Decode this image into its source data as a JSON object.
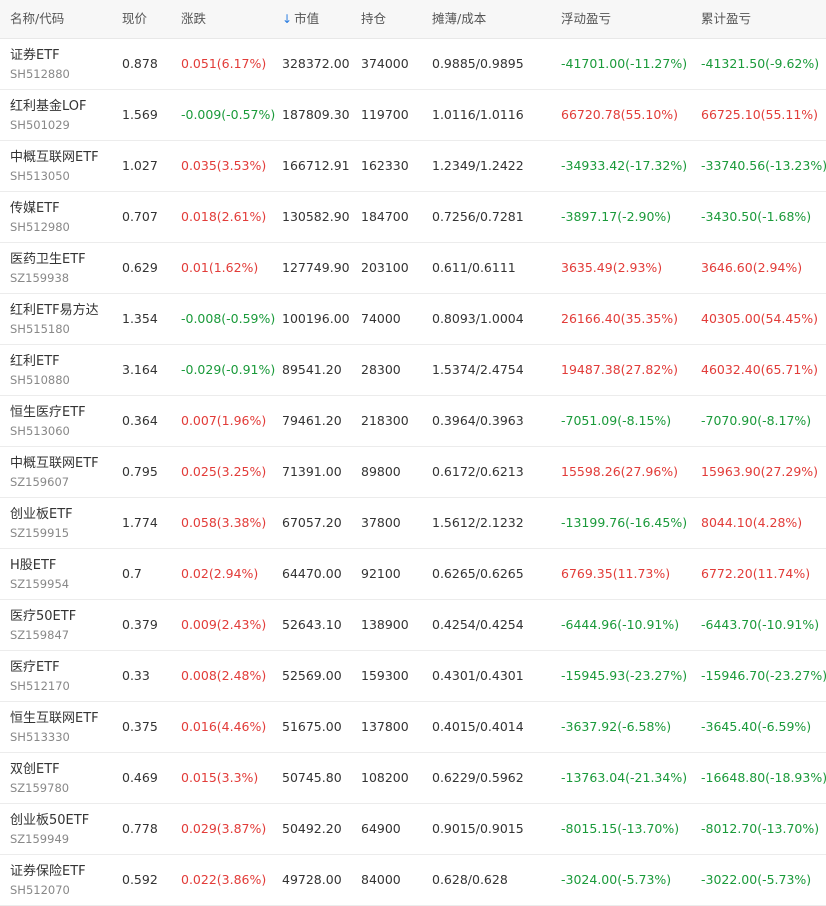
{
  "colors": {
    "up": "#e23c39",
    "down": "#1a9a3a",
    "header_bg": "#f7f7f7",
    "sort_arrow": "#2a7de1"
  },
  "header": {
    "name_code": "名称/代码",
    "price": "现价",
    "change": "涨跌",
    "sort_icon": "↓",
    "market_value": "市值",
    "position": "持仓",
    "cost": "摊薄/成本",
    "floating_pl": "浮动盈亏",
    "total_pl": "累计盈亏"
  },
  "rows": [
    {
      "name": "证券ETF",
      "code": "SH512880",
      "price": "0.878",
      "change": "0.051(6.17%)",
      "change_dir": "up",
      "market_value": "328372.00",
      "position": "374000",
      "cost": "0.9885/0.9895",
      "floating_pl": "-41701.00(-11.27%)",
      "floating_dir": "down",
      "total_pl": "-41321.50(-9.62%)",
      "total_dir": "down"
    },
    {
      "name": "红利基金LOF",
      "code": "SH501029",
      "price": "1.569",
      "change": "-0.009(-0.57%)",
      "change_dir": "down",
      "market_value": "187809.30",
      "position": "119700",
      "cost": "1.0116/1.0116",
      "floating_pl": "66720.78(55.10%)",
      "floating_dir": "up",
      "total_pl": "66725.10(55.11%)",
      "total_dir": "up"
    },
    {
      "name": "中概互联网ETF",
      "code": "SH513050",
      "price": "1.027",
      "change": "0.035(3.53%)",
      "change_dir": "up",
      "market_value": "166712.91",
      "position": "162330",
      "cost": "1.2349/1.2422",
      "floating_pl": "-34933.42(-17.32%)",
      "floating_dir": "down",
      "total_pl": "-33740.56(-13.23%)",
      "total_dir": "down"
    },
    {
      "name": "传媒ETF",
      "code": "SH512980",
      "price": "0.707",
      "change": "0.018(2.61%)",
      "change_dir": "up",
      "market_value": "130582.90",
      "position": "184700",
      "cost": "0.7256/0.7281",
      "floating_pl": "-3897.17(-2.90%)",
      "floating_dir": "down",
      "total_pl": "-3430.50(-1.68%)",
      "total_dir": "down"
    },
    {
      "name": "医药卫生ETF",
      "code": "SZ159938",
      "price": "0.629",
      "change": "0.01(1.62%)",
      "change_dir": "up",
      "market_value": "127749.90",
      "position": "203100",
      "cost": "0.611/0.6111",
      "floating_pl": "3635.49(2.93%)",
      "floating_dir": "up",
      "total_pl": "3646.60(2.94%)",
      "total_dir": "up"
    },
    {
      "name": "红利ETF易方达",
      "code": "SH515180",
      "price": "1.354",
      "change": "-0.008(-0.59%)",
      "change_dir": "down",
      "market_value": "100196.00",
      "position": "74000",
      "cost": "0.8093/1.0004",
      "floating_pl": "26166.40(35.35%)",
      "floating_dir": "up",
      "total_pl": "40305.00(54.45%)",
      "total_dir": "up"
    },
    {
      "name": "红利ETF",
      "code": "SH510880",
      "price": "3.164",
      "change": "-0.029(-0.91%)",
      "change_dir": "down",
      "market_value": "89541.20",
      "position": "28300",
      "cost": "1.5374/2.4754",
      "floating_pl": "19487.38(27.82%)",
      "floating_dir": "up",
      "total_pl": "46032.40(65.71%)",
      "total_dir": "up"
    },
    {
      "name": "恒生医疗ETF",
      "code": "SH513060",
      "price": "0.364",
      "change": "0.007(1.96%)",
      "change_dir": "up",
      "market_value": "79461.20",
      "position": "218300",
      "cost": "0.3964/0.3963",
      "floating_pl": "-7051.09(-8.15%)",
      "floating_dir": "down",
      "total_pl": "-7070.90(-8.17%)",
      "total_dir": "down"
    },
    {
      "name": "中概互联网ETF",
      "code": "SZ159607",
      "price": "0.795",
      "change": "0.025(3.25%)",
      "change_dir": "up",
      "market_value": "71391.00",
      "position": "89800",
      "cost": "0.6172/0.6213",
      "floating_pl": "15598.26(27.96%)",
      "floating_dir": "up",
      "total_pl": "15963.90(27.29%)",
      "total_dir": "up"
    },
    {
      "name": "创业板ETF",
      "code": "SZ159915",
      "price": "1.774",
      "change": "0.058(3.38%)",
      "change_dir": "up",
      "market_value": "67057.20",
      "position": "37800",
      "cost": "1.5612/2.1232",
      "floating_pl": "-13199.76(-16.45%)",
      "floating_dir": "down",
      "total_pl": "8044.10(4.28%)",
      "total_dir": "up"
    },
    {
      "name": "H股ETF",
      "code": "SZ159954",
      "price": "0.7",
      "change": "0.02(2.94%)",
      "change_dir": "up",
      "market_value": "64470.00",
      "position": "92100",
      "cost": "0.6265/0.6265",
      "floating_pl": "6769.35(11.73%)",
      "floating_dir": "up",
      "total_pl": "6772.20(11.74%)",
      "total_dir": "up"
    },
    {
      "name": "医疗50ETF",
      "code": "SZ159847",
      "price": "0.379",
      "change": "0.009(2.43%)",
      "change_dir": "up",
      "market_value": "52643.10",
      "position": "138900",
      "cost": "0.4254/0.4254",
      "floating_pl": "-6444.96(-10.91%)",
      "floating_dir": "down",
      "total_pl": "-6443.70(-10.91%)",
      "total_dir": "down"
    },
    {
      "name": "医疗ETF",
      "code": "SH512170",
      "price": "0.33",
      "change": "0.008(2.48%)",
      "change_dir": "up",
      "market_value": "52569.00",
      "position": "159300",
      "cost": "0.4301/0.4301",
      "floating_pl": "-15945.93(-23.27%)",
      "floating_dir": "down",
      "total_pl": "-15946.70(-23.27%)",
      "total_dir": "down"
    },
    {
      "name": "恒生互联网ETF",
      "code": "SH513330",
      "price": "0.375",
      "change": "0.016(4.46%)",
      "change_dir": "up",
      "market_value": "51675.00",
      "position": "137800",
      "cost": "0.4015/0.4014",
      "floating_pl": "-3637.92(-6.58%)",
      "floating_dir": "down",
      "total_pl": "-3645.40(-6.59%)",
      "total_dir": "down"
    },
    {
      "name": "双创ETF",
      "code": "SZ159780",
      "price": "0.469",
      "change": "0.015(3.3%)",
      "change_dir": "up",
      "market_value": "50745.80",
      "position": "108200",
      "cost": "0.6229/0.5962",
      "floating_pl": "-13763.04(-21.34%)",
      "floating_dir": "down",
      "total_pl": "-16648.80(-18.93%)",
      "total_dir": "down"
    },
    {
      "name": "创业板50ETF",
      "code": "SZ159949",
      "price": "0.778",
      "change": "0.029(3.87%)",
      "change_dir": "up",
      "market_value": "50492.20",
      "position": "64900",
      "cost": "0.9015/0.9015",
      "floating_pl": "-8015.15(-13.70%)",
      "floating_dir": "down",
      "total_pl": "-8012.70(-13.70%)",
      "total_dir": "down"
    },
    {
      "name": "证券保险ETF",
      "code": "SH512070",
      "price": "0.592",
      "change": "0.022(3.86%)",
      "change_dir": "up",
      "market_value": "49728.00",
      "position": "84000",
      "cost": "0.628/0.628",
      "floating_pl": "-3024.00(-5.73%)",
      "floating_dir": "down",
      "total_pl": "-3022.00(-5.73%)",
      "total_dir": "down"
    }
  ]
}
